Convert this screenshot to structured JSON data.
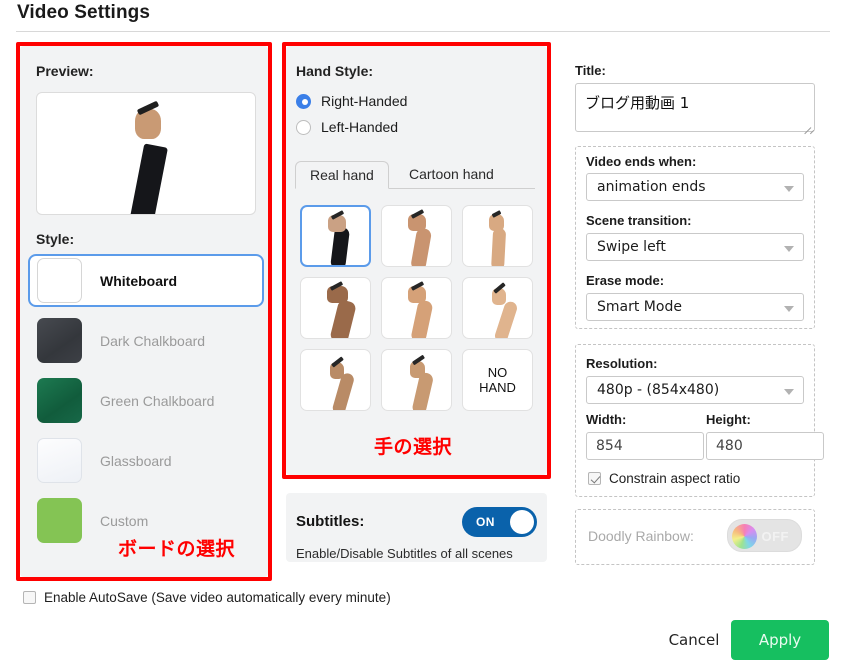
{
  "header": {
    "title": "Video Settings"
  },
  "annotations": {
    "board_select": "ボードの選択",
    "hand_select": "手の選択"
  },
  "preview": {
    "label": "Preview:"
  },
  "style": {
    "label": "Style:",
    "items": [
      {
        "label": "Whiteboard",
        "swatch": "whiteboard",
        "color": "#ffffff",
        "selected": true
      },
      {
        "label": "Dark Chalkboard",
        "swatch": "darkchalk",
        "color": "#3d4046",
        "selected": false
      },
      {
        "label": "Green Chalkboard",
        "swatch": "greenchalk",
        "color": "#176848",
        "selected": false
      },
      {
        "label": "Glassboard",
        "swatch": "glassboard",
        "color": "#eef1f6",
        "selected": false
      },
      {
        "label": "Custom",
        "swatch": "custom",
        "color": "#84c454",
        "selected": false
      }
    ]
  },
  "hand_style": {
    "label": "Hand Style:",
    "handedness": [
      {
        "label": "Right-Handed",
        "selected": true
      },
      {
        "label": "Left-Handed",
        "selected": false
      }
    ],
    "tabs": [
      {
        "label": "Real hand",
        "active": true
      },
      {
        "label": "Cartoon hand",
        "active": false
      }
    ],
    "hands": [
      {
        "name": "hand-1",
        "selected": true,
        "skin": "#caa184",
        "sleeve": "#15161a"
      },
      {
        "name": "hand-2",
        "selected": false,
        "skin": "#c99470",
        "sleeve": ""
      },
      {
        "name": "hand-3",
        "selected": false,
        "skin": "#d8a982",
        "sleeve": ""
      },
      {
        "name": "hand-4",
        "selected": false,
        "skin": "#9a6a4a",
        "sleeve": ""
      },
      {
        "name": "hand-5",
        "selected": false,
        "skin": "#d5a178",
        "sleeve": ""
      },
      {
        "name": "hand-6",
        "selected": false,
        "skin": "#e0b48e",
        "sleeve": ""
      },
      {
        "name": "hand-7",
        "selected": false,
        "skin": "#b98b66",
        "sleeve": ""
      },
      {
        "name": "hand-8",
        "selected": false,
        "skin": "#c89a72",
        "sleeve": ""
      },
      {
        "name": "no-hand",
        "selected": false,
        "label": "NO\nHAND"
      }
    ],
    "no_hand_line1": "NO",
    "no_hand_line2": "HAND"
  },
  "subtitles": {
    "label": "Subtitles:",
    "toggle_state": "ON",
    "help": "Enable/Disable Subtitles of all scenes",
    "accent": "#0a62ab"
  },
  "title_field": {
    "label": "Title:",
    "value": "ブログ用動画 1"
  },
  "playback": {
    "video_ends_label": "Video ends when:",
    "video_ends_value": "animation ends",
    "scene_transition_label": "Scene transition:",
    "scene_transition_value": "Swipe left",
    "erase_mode_label": "Erase mode:",
    "erase_mode_value": "Smart Mode"
  },
  "resolution": {
    "label": "Resolution:",
    "value": "480p  -  (854x480)",
    "width_label": "Width:",
    "width_value": "854",
    "height_label": "Height:",
    "height_value": "480",
    "constrain_label": "Constrain aspect ratio",
    "constrain_checked": true
  },
  "rainbow": {
    "label": "Doodly Rainbow:",
    "toggle_state": "OFF",
    "disabled": true
  },
  "autosave": {
    "label": "Enable AutoSave (Save video automatically every minute)",
    "checked": false
  },
  "footer": {
    "cancel_label": "Cancel",
    "apply_label": "Apply",
    "apply_color": "#16bf60"
  }
}
